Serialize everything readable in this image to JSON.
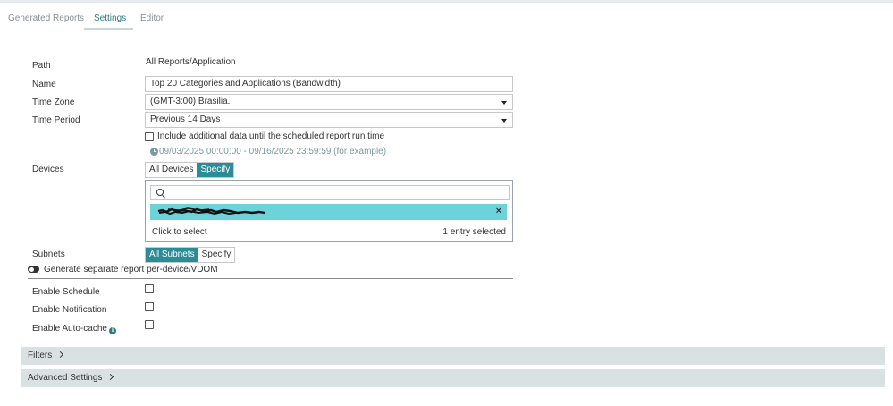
{
  "tabs": [
    {
      "label": "Generated Reports",
      "active": false
    },
    {
      "label": "Settings",
      "active": true
    },
    {
      "label": "Editor",
      "active": false
    }
  ],
  "form": {
    "path": {
      "label": "Path",
      "value": "All Reports/Application"
    },
    "name": {
      "label": "Name",
      "value": "Top 20 Categories and Applications (Bandwidth)"
    },
    "time_zone": {
      "label": "Time Zone",
      "value": "(GMT-3:00) Brasilia."
    },
    "time_period": {
      "label": "Time Period",
      "value": "Previous 14 Days",
      "include_additional_label": "Include additional data until the scheduled report run time",
      "include_additional_checked": false,
      "example": "09/03/2025 00:00:00 - 09/16/2025 23:59:59 (for example)"
    },
    "devices": {
      "label": "Devices",
      "options": [
        "All Devices",
        "Specify"
      ],
      "selected": "Specify",
      "search_placeholder": "",
      "click_to_select": "Click to select",
      "selected_count": "1 entry selected"
    },
    "subnets": {
      "label": "Subnets",
      "options": [
        "All Subnets",
        "Specify"
      ],
      "selected": "All Subnets"
    },
    "separate_report": {
      "label": "Generate separate report per-device/VDOM",
      "on": false
    },
    "enable_schedule": {
      "label": "Enable Schedule",
      "checked": false
    },
    "enable_notification": {
      "label": "Enable Notification",
      "checked": false
    },
    "enable_autocache": {
      "label": "Enable Auto-cache",
      "checked": false
    }
  },
  "sections": {
    "filters": "Filters",
    "advanced": "Advanced Settings"
  },
  "colors": {
    "accent": "#2b8b96",
    "chip": "#6dd3da",
    "section_bg": "#d9e1e3",
    "example_text": "#7b9aa0"
  },
  "icons": {
    "time_zone_dropdown": "caret-down-icon",
    "time_period_dropdown": "caret-down-icon",
    "example_clock": "clock-icon",
    "device_search": "search-icon",
    "chip_remove": "close-icon",
    "autocache_info": "info-icon",
    "section_expand": "chevron-right-icon"
  }
}
